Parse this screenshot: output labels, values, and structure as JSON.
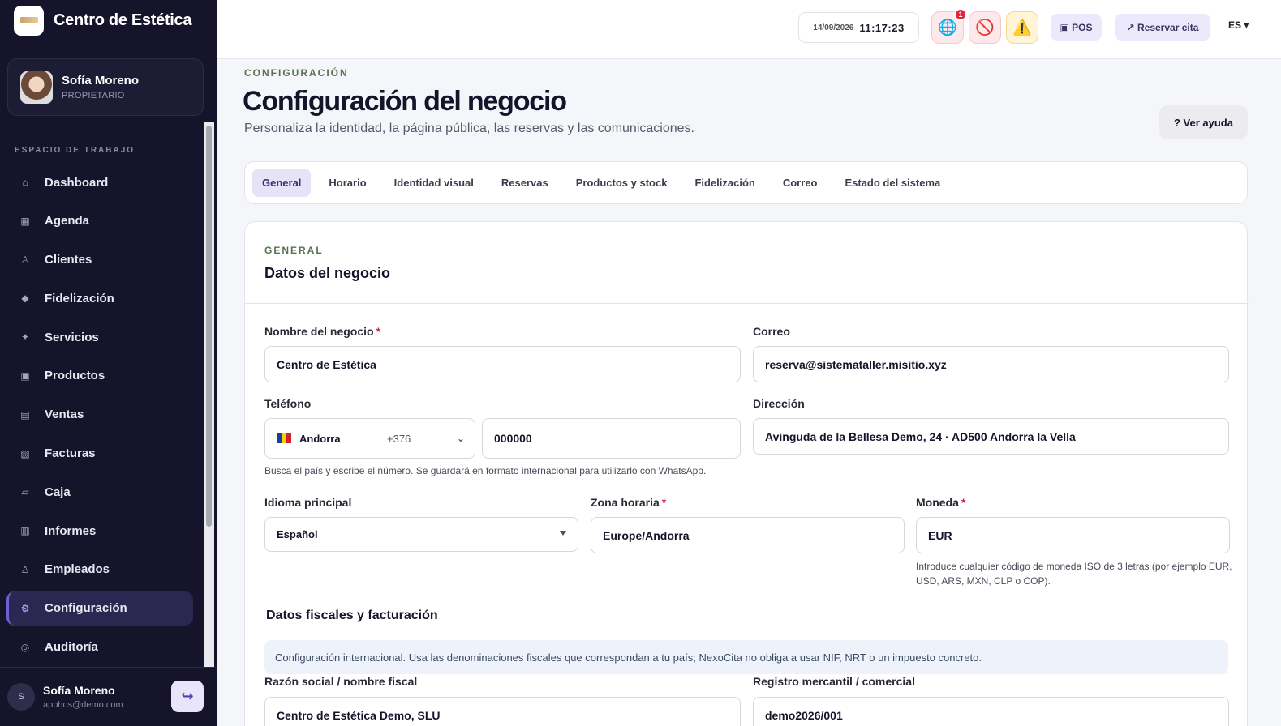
{
  "sidebar": {
    "brand_name": "Centro de Estética",
    "user": {
      "name": "Sofía Moreno",
      "role": "PROPIETARIO"
    },
    "workspace_label": "ESPACIO DE TRABAJO",
    "items": [
      {
        "label": "Dashboard",
        "icon": "⌂",
        "active": false
      },
      {
        "label": "Agenda",
        "icon": "▦",
        "active": false
      },
      {
        "label": "Clientes",
        "icon": "♙",
        "active": false
      },
      {
        "label": "Fidelización",
        "icon": "◆",
        "active": false
      },
      {
        "label": "Servicios",
        "icon": "✦",
        "active": false
      },
      {
        "label": "Productos",
        "icon": "▣",
        "active": false
      },
      {
        "label": "Ventas",
        "icon": "▤",
        "active": false
      },
      {
        "label": "Facturas",
        "icon": "▧",
        "active": false
      },
      {
        "label": "Caja",
        "icon": "▱",
        "active": false
      },
      {
        "label": "Informes",
        "icon": "▥",
        "active": false
      },
      {
        "label": "Empleados",
        "icon": "♙",
        "active": false
      },
      {
        "label": "Configuración",
        "icon": "⚙",
        "active": true
      },
      {
        "label": "Auditoría",
        "icon": "◎",
        "active": false
      }
    ],
    "footer": {
      "initial": "S",
      "name": "Sofía Moreno",
      "email": "apphos@demo.com",
      "logout_icon": "↪"
    }
  },
  "topbar": {
    "date": "14/09/2026",
    "time": "11:17:23",
    "notification_count": "1",
    "globe_icon": "🌐",
    "block_icon": "🚫",
    "warn_icon": "⚠️",
    "pos_label": "▣ POS",
    "book_label": "↗ Reservar cita",
    "lang_label": "ES ▾"
  },
  "page": {
    "eyebrow": "CONFIGURACIÓN",
    "title": "Configuración del negocio",
    "subtitle": "Personaliza la identidad, la página pública, las reservas y las comunicaciones.",
    "help_label": "? Ver ayuda"
  },
  "tabs": [
    {
      "label": "General",
      "active": true
    },
    {
      "label": "Horario",
      "active": false
    },
    {
      "label": "Identidad visual",
      "active": false
    },
    {
      "label": "Reservas",
      "active": false
    },
    {
      "label": "Productos y stock",
      "active": false
    },
    {
      "label": "Fidelización",
      "active": false
    },
    {
      "label": "Correo",
      "active": false
    },
    {
      "label": "Estado del sistema",
      "active": false
    }
  ],
  "card": {
    "eyebrow": "GENERAL",
    "title": "Datos del negocio",
    "business_name": {
      "label": "Nombre del negocio",
      "required": "*",
      "value": "Centro de Estética"
    },
    "email": {
      "label": "Correo",
      "value": "reserva@sistemataller.misitio.xyz"
    },
    "phone": {
      "label": "Teléfono",
      "country": "Andorra",
      "dial_code": "+376",
      "chevron": "⌄",
      "number": "000000",
      "help": "Busca el país y escribe el número. Se guardará en formato internacional para utilizarlo con WhatsApp."
    },
    "address": {
      "label": "Dirección",
      "value": "Avinguda de la Bellesa Demo, 24 · AD500 Andorra la Vella"
    },
    "language": {
      "label": "Idioma principal",
      "value": "Español"
    },
    "timezone": {
      "label": "Zona horaria",
      "required": "*",
      "value": "Europe/Andorra"
    },
    "currency": {
      "label": "Moneda",
      "required": "*",
      "value": "EUR",
      "help": "Introduce cualquier código de moneda ISO de 3 letras (por ejemplo EUR, USD, ARS, MXN, CLP o COP)."
    },
    "fiscal_section_title": "Datos fiscales y facturación",
    "fiscal_info": "Configuración internacional. Usa las denominaciones fiscales que correspondan a tu país; NexoCita no obliga a usar NIF, NRT o un impuesto concreto.",
    "legal_name": {
      "label": "Razón social / nombre fiscal",
      "value": "Centro de Estética Demo, SLU"
    },
    "registry": {
      "label": "Registro mercantil / comercial",
      "value": "demo2026/001"
    }
  }
}
